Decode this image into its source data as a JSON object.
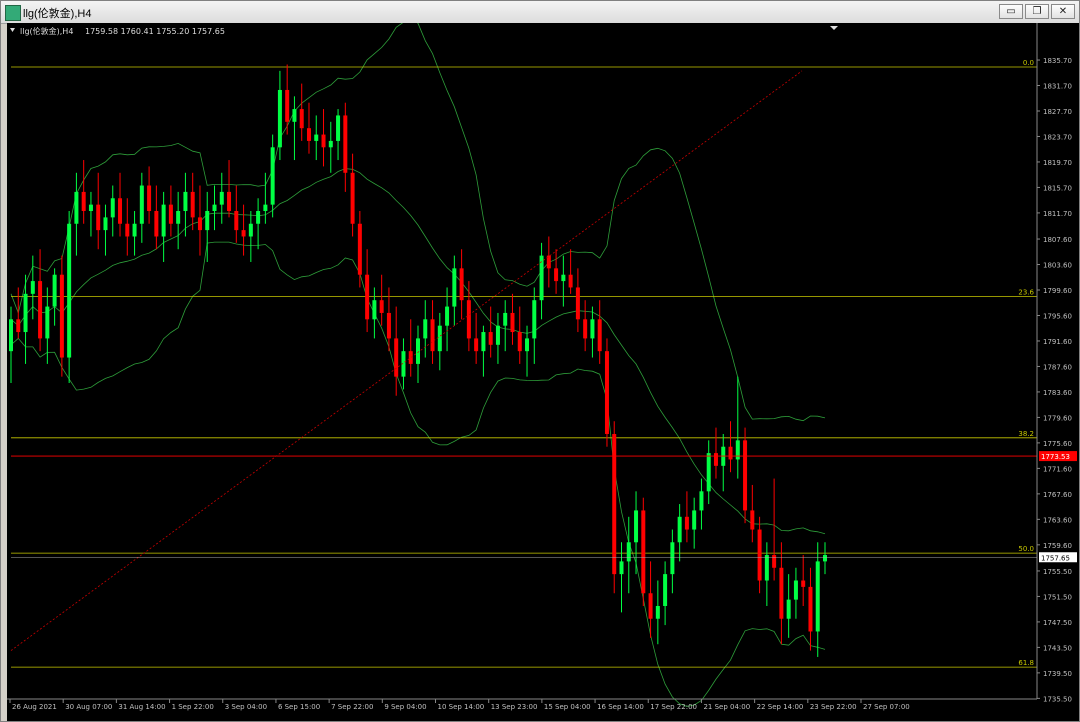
{
  "window": {
    "title": "llg(伦敦金),H4",
    "buttons": {
      "minimize": "▭",
      "restore": "❐",
      "close": "✕"
    }
  },
  "chart_header": {
    "symbol": "llg(伦敦金),H4",
    "ohlc": "1759.58 1760.41 1755.20 1757.65"
  },
  "colors": {
    "background": "#000000",
    "bull": "#00ff44",
    "bear": "#ff0000",
    "bands": "#2e9e3a",
    "fibo": "#c8c800",
    "hline": "#ff0000",
    "trend": "#c80000",
    "axis_text": "#c0c0c0"
  },
  "chart_data": {
    "type": "candlestick",
    "ylim": [
      1735.4,
      1839.0
    ],
    "y_ticks": [
      "1835.70",
      "1831.70",
      "1827.70",
      "1823.70",
      "1819.70",
      "1815.70",
      "1811.70",
      "1807.60",
      "1803.60",
      "1799.60",
      "1795.60",
      "1791.60",
      "1787.60",
      "1783.60",
      "1779.60",
      "1775.60",
      "1771.60",
      "1767.60",
      "1763.60",
      "1759.60",
      "1755.50",
      "1751.50",
      "1747.50",
      "1743.50",
      "1739.50",
      "1735.50"
    ],
    "x_ticks": [
      "26 Aug 2021",
      "30 Aug 07:00",
      "31 Aug 14:00",
      "1 Sep 22:00",
      "3 Sep 04:00",
      "6 Sep 15:00",
      "7 Sep 22:00",
      "9 Sep 04:00",
      "10 Sep 14:00",
      "13 Sep 23:00",
      "15 Sep 04:00",
      "16 Sep 14:00",
      "17 Sep 22:00",
      "21 Sep 04:00",
      "22 Sep 14:00",
      "23 Sep 22:00",
      "27 Sep 07:00"
    ],
    "fibo_levels": [
      {
        "label": "0.0",
        "price": 1834.6
      },
      {
        "label": "23.6",
        "price": 1798.6
      },
      {
        "label": "38.2",
        "price": 1776.4
      },
      {
        "label": "50.0",
        "price": 1758.3
      },
      {
        "label": "61.8",
        "price": 1740.4
      }
    ],
    "current_price_label": "1757.65",
    "red_line_label": "1773.53",
    "red_line_price": 1773.53,
    "candles": [
      [
        1790,
        1797,
        1785,
        1795
      ],
      [
        1795,
        1800,
        1792,
        1793
      ],
      [
        1793,
        1802,
        1788,
        1799
      ],
      [
        1799,
        1805,
        1795,
        1801
      ],
      [
        1801,
        1806,
        1790,
        1792
      ],
      [
        1792,
        1800,
        1788,
        1797
      ],
      [
        1797,
        1803,
        1794,
        1802
      ],
      [
        1802,
        1805,
        1786,
        1789
      ],
      [
        1789,
        1812,
        1785,
        1810
      ],
      [
        1810,
        1818,
        1805,
        1815
      ],
      [
        1815,
        1820,
        1810,
        1812
      ],
      [
        1812,
        1815,
        1808,
        1813
      ],
      [
        1813,
        1818,
        1806,
        1809
      ],
      [
        1809,
        1813,
        1805,
        1811
      ],
      [
        1811,
        1816,
        1808,
        1814
      ],
      [
        1814,
        1818,
        1808,
        1810
      ],
      [
        1810,
        1814,
        1805,
        1808
      ],
      [
        1808,
        1812,
        1805,
        1810
      ],
      [
        1810,
        1818,
        1807,
        1816
      ],
      [
        1816,
        1819,
        1810,
        1812
      ],
      [
        1812,
        1816,
        1806,
        1808
      ],
      [
        1808,
        1815,
        1804,
        1813
      ],
      [
        1813,
        1816,
        1808,
        1810
      ],
      [
        1810,
        1815,
        1806,
        1812
      ],
      [
        1812,
        1818,
        1808,
        1815
      ],
      [
        1815,
        1818,
        1809,
        1811
      ],
      [
        1811,
        1816,
        1805,
        1809
      ],
      [
        1809,
        1815,
        1804,
        1812
      ],
      [
        1812,
        1816,
        1809,
        1813
      ],
      [
        1813,
        1818,
        1810,
        1815
      ],
      [
        1815,
        1820,
        1811,
        1812
      ],
      [
        1812,
        1816,
        1807,
        1809
      ],
      [
        1809,
        1813,
        1805,
        1808
      ],
      [
        1808,
        1812,
        1804,
        1810
      ],
      [
        1810,
        1814,
        1806,
        1812
      ],
      [
        1812,
        1818,
        1810,
        1813
      ],
      [
        1813,
        1824,
        1811,
        1822
      ],
      [
        1822,
        1834,
        1820,
        1831
      ],
      [
        1831,
        1835,
        1824,
        1826
      ],
      [
        1826,
        1830,
        1820,
        1828
      ],
      [
        1828,
        1832,
        1823,
        1825
      ],
      [
        1825,
        1829,
        1821,
        1823
      ],
      [
        1823,
        1827,
        1820,
        1824
      ],
      [
        1824,
        1828,
        1819,
        1822
      ],
      [
        1822,
        1826,
        1818,
        1823
      ],
      [
        1823,
        1828,
        1820,
        1827
      ],
      [
        1827,
        1829,
        1815,
        1818
      ],
      [
        1818,
        1821,
        1808,
        1810
      ],
      [
        1810,
        1812,
        1800,
        1802
      ],
      [
        1802,
        1806,
        1793,
        1795
      ],
      [
        1795,
        1800,
        1792,
        1798
      ],
      [
        1798,
        1802,
        1794,
        1796
      ],
      [
        1796,
        1800,
        1790,
        1792
      ],
      [
        1792,
        1797,
        1783,
        1786
      ],
      [
        1786,
        1792,
        1784,
        1790
      ],
      [
        1790,
        1795,
        1786,
        1788
      ],
      [
        1788,
        1794,
        1785,
        1792
      ],
      [
        1792,
        1798,
        1789,
        1795
      ],
      [
        1795,
        1798,
        1788,
        1790
      ],
      [
        1790,
        1796,
        1787,
        1794
      ],
      [
        1794,
        1800,
        1790,
        1797
      ],
      [
        1797,
        1805,
        1794,
        1803
      ],
      [
        1803,
        1806,
        1795,
        1798
      ],
      [
        1798,
        1801,
        1790,
        1792
      ],
      [
        1792,
        1796,
        1788,
        1790
      ],
      [
        1790,
        1794,
        1786,
        1793
      ],
      [
        1793,
        1797,
        1789,
        1791
      ],
      [
        1791,
        1796,
        1788,
        1794
      ],
      [
        1794,
        1798,
        1790,
        1796
      ],
      [
        1796,
        1799,
        1791,
        1793
      ],
      [
        1793,
        1797,
        1788,
        1790
      ],
      [
        1790,
        1794,
        1786,
        1792
      ],
      [
        1792,
        1800,
        1788,
        1798
      ],
      [
        1798,
        1807,
        1795,
        1805
      ],
      [
        1805,
        1808,
        1800,
        1803
      ],
      [
        1803,
        1806,
        1799,
        1801
      ],
      [
        1801,
        1805,
        1797,
        1802
      ],
      [
        1802,
        1806,
        1799,
        1800
      ],
      [
        1800,
        1803,
        1793,
        1795
      ],
      [
        1795,
        1798,
        1790,
        1792
      ],
      [
        1792,
        1797,
        1789,
        1795
      ],
      [
        1795,
        1798,
        1788,
        1790
      ],
      [
        1790,
        1792,
        1775,
        1777
      ],
      [
        1777,
        1779,
        1752,
        1755
      ],
      [
        1755,
        1760,
        1749,
        1757
      ],
      [
        1757,
        1764,
        1752,
        1760
      ],
      [
        1760,
        1768,
        1755,
        1765
      ],
      [
        1765,
        1767,
        1750,
        1752
      ],
      [
        1752,
        1757,
        1745,
        1748
      ],
      [
        1748,
        1754,
        1744,
        1750
      ],
      [
        1750,
        1757,
        1747,
        1755
      ],
      [
        1755,
        1762,
        1752,
        1760
      ],
      [
        1760,
        1766,
        1757,
        1764
      ],
      [
        1764,
        1768,
        1760,
        1762
      ],
      [
        1762,
        1767,
        1759,
        1765
      ],
      [
        1765,
        1770,
        1762,
        1768
      ],
      [
        1768,
        1776,
        1766,
        1774
      ],
      [
        1774,
        1778,
        1770,
        1772
      ],
      [
        1772,
        1777,
        1768,
        1775
      ],
      [
        1775,
        1779,
        1771,
        1773
      ],
      [
        1773,
        1786,
        1770,
        1776
      ],
      [
        1776,
        1778,
        1763,
        1765
      ],
      [
        1765,
        1769,
        1760,
        1762
      ],
      [
        1762,
        1764,
        1752,
        1754
      ],
      [
        1754,
        1760,
        1750,
        1758
      ],
      [
        1758,
        1770,
        1754,
        1756
      ],
      [
        1756,
        1760,
        1744,
        1748
      ],
      [
        1748,
        1755,
        1745,
        1751
      ],
      [
        1751,
        1756,
        1748,
        1754
      ],
      [
        1754,
        1758,
        1750,
        1753
      ],
      [
        1753,
        1756,
        1743,
        1746
      ],
      [
        1746,
        1760,
        1742,
        1757
      ],
      [
        1757,
        1760,
        1755,
        1758
      ]
    ]
  }
}
